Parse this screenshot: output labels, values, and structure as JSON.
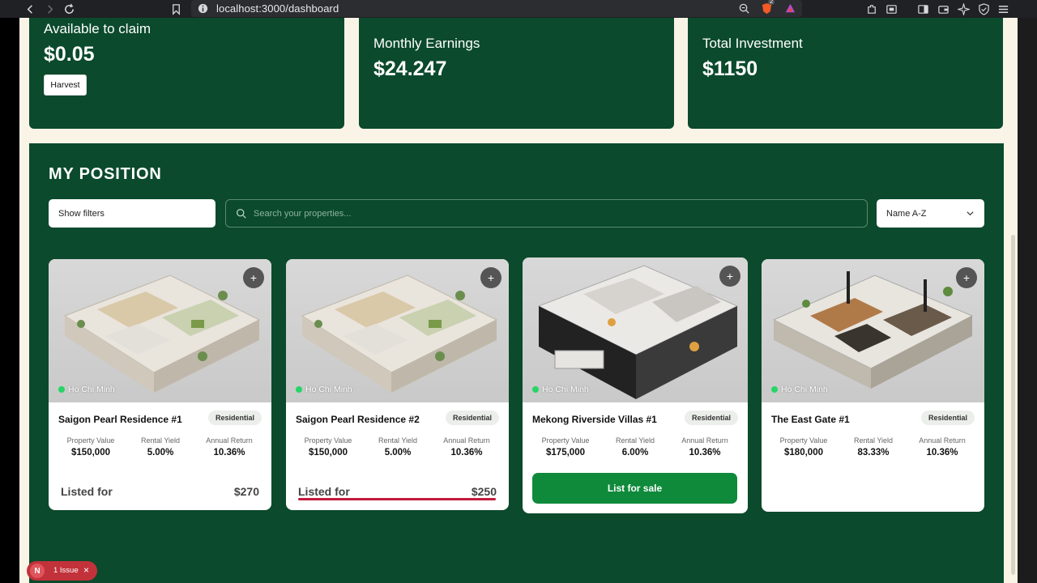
{
  "browser": {
    "url": "localhost:3000/dashboard",
    "brave_badge": "2"
  },
  "stats": {
    "available": {
      "label": "Available to claim",
      "value": "$0.05",
      "button": "Harvest"
    },
    "monthly": {
      "label": "Monthly Earnings",
      "value": "$24.247"
    },
    "investment": {
      "label": "Total Investment",
      "value": "$1150"
    }
  },
  "position": {
    "title": "MY POSITION",
    "filters_label": "Show filters",
    "search_placeholder": "Search your properties...",
    "sort_value": "Name A-Z"
  },
  "metric_labels": {
    "value": "Property Value",
    "yield": "Rental Yield",
    "return": "Annual Return"
  },
  "cards": [
    {
      "location": "Ho Chi Minh",
      "name": "Saigon Pearl Residence #1",
      "type": "Residential",
      "value": "$150,000",
      "yield": "5.00%",
      "return": "10.36%",
      "listed_label": "Listed for",
      "listed_price": "$270"
    },
    {
      "location": "Ho Chi Minh",
      "name": "Saigon Pearl Residence #2",
      "type": "Residential",
      "value": "$150,000",
      "yield": "5.00%",
      "return": "10.36%",
      "listed_label": "Listed for",
      "listed_price": "$250"
    },
    {
      "location": "Ho Chi Minh",
      "name": "Mekong Riverside Villas #1",
      "type": "Residential",
      "value": "$175,000",
      "yield": "6.00%",
      "return": "10.36%",
      "action": "List for sale"
    },
    {
      "location": "Ho Chi Minh",
      "name": "The East Gate #1",
      "type": "Residential",
      "value": "$180,000",
      "yield": "83.33%",
      "return": "10.36%"
    }
  ],
  "issue": {
    "logo": "N",
    "text": "1 Issue"
  },
  "colors": {
    "panel": "#0b4a2c",
    "page_bg": "#faf4e6",
    "sale_button": "#0f8a3b",
    "underline": "#c31b3b",
    "location_dot": "#26d666"
  }
}
